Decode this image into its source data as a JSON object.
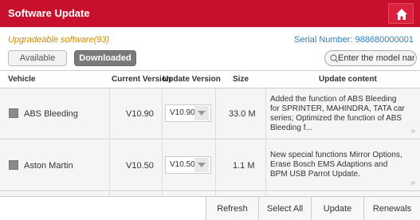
{
  "header": {
    "title": "Software Update",
    "home_icon": "home-icon"
  },
  "info": {
    "upgradeable": "Upgradeable software(93)",
    "serial": "Serial Number: 988680000001"
  },
  "tabs": {
    "available": "Available",
    "downloaded": "Downloaded"
  },
  "search": {
    "placeholder": "Enter the model name"
  },
  "table": {
    "headers": [
      "Vehicle",
      "Current Version",
      "Update Version",
      "Size",
      "Update content"
    ],
    "rows": [
      {
        "vehicle": "ABS Bleeding",
        "current": "V10.90",
        "update": "V10.90",
        "size": "33.0 M",
        "content": "Added the function of ABS Bleeding for SPRINTER, MAHINDRA, TATA car series; Optimized the function of ABS Bleeding f...",
        "more": "»"
      },
      {
        "vehicle": "Aston Martin",
        "current": "V10.50",
        "update": "V10.50",
        "size": "1.1 M",
        "content": "New special functions Mirror Options, Erase Bosch EMS Adaptions and BPM USB Parrot Update.",
        "more": "»"
      }
    ]
  },
  "footer": {
    "refresh": "Refresh",
    "select_all": "Select All",
    "update": "Update",
    "renewals": "Renewals"
  },
  "colors": {
    "brand": "#c8102e",
    "serial": "#2a7fbf",
    "upgradeable": "#d08a00"
  }
}
